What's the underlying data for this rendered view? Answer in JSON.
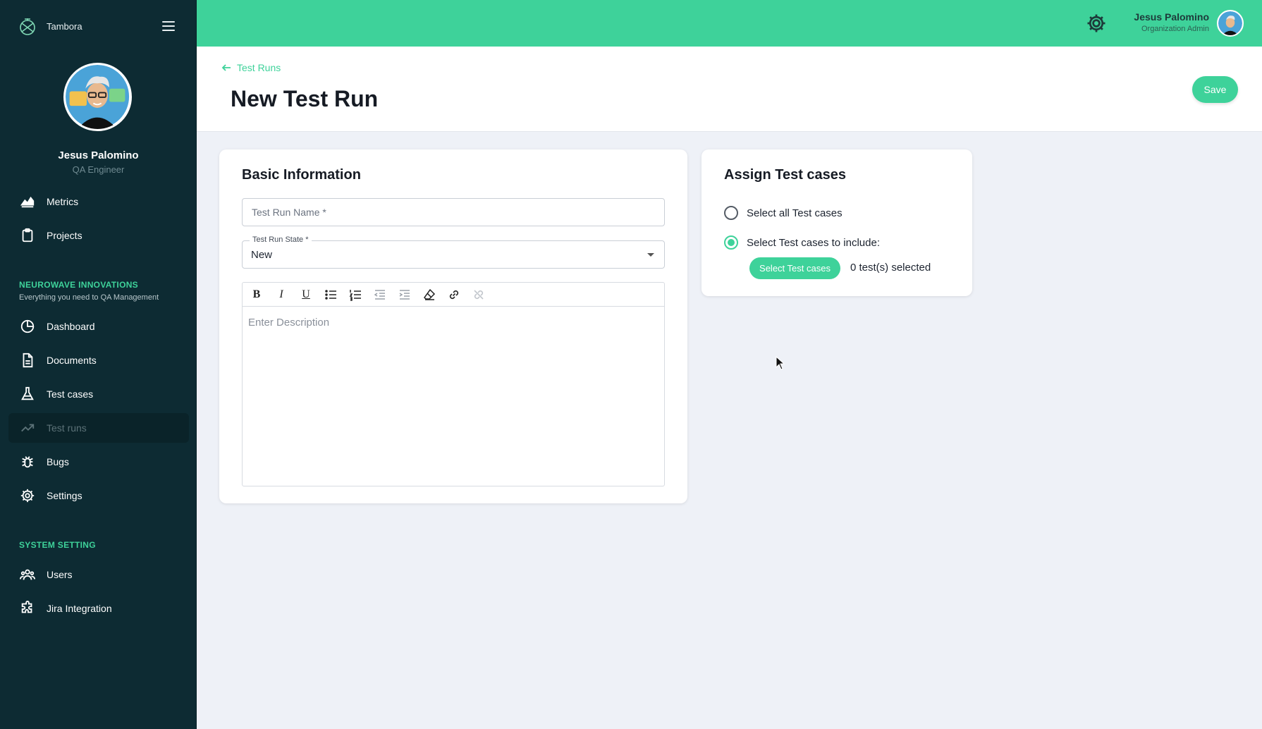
{
  "app": {
    "brand_name": "Tambora"
  },
  "profile": {
    "name": "Jesus Palomino",
    "role": "QA Engineer"
  },
  "sidebar": {
    "top_items": [
      {
        "label": "Metrics",
        "icon": "chart-area-icon"
      },
      {
        "label": "Projects",
        "icon": "clipboard-icon"
      }
    ],
    "org_title": "NEUROWAVE INNOVATIONS",
    "org_subtitle": "Everything you need to QA Management",
    "org_items": [
      {
        "label": "Dashboard",
        "icon": "pie-chart-icon"
      },
      {
        "label": "Documents",
        "icon": "document-icon"
      },
      {
        "label": "Test cases",
        "icon": "flask-icon"
      },
      {
        "label": "Test runs",
        "icon": "trend-up-icon",
        "active": true
      },
      {
        "label": "Bugs",
        "icon": "bug-icon"
      },
      {
        "label": "Settings",
        "icon": "gear-icon"
      }
    ],
    "system_title": "SYSTEM SETTING",
    "system_items": [
      {
        "label": "Users",
        "icon": "users-icon"
      },
      {
        "label": "Jira Integration",
        "icon": "puzzle-icon"
      }
    ]
  },
  "topbar": {
    "user_name": "Jesus Palomino",
    "user_role": "Organization Admin",
    "settings_icon": "gear-icon"
  },
  "header": {
    "back_label": "Test Runs",
    "title": "New Test Run",
    "save_label": "Save"
  },
  "basic_info": {
    "title": "Basic Information",
    "name_placeholder": "Test Run Name *",
    "name_value": "",
    "state_label": "Test Run State *",
    "state_value": "New",
    "description_placeholder": "Enter Description"
  },
  "assign": {
    "title": "Assign Test cases",
    "option_all": "Select all Test cases",
    "option_include": "Select Test cases to include:",
    "selected_option": "include",
    "select_button": "Select Test cases",
    "selected_count": "0 test(s) selected"
  },
  "colors": {
    "accent": "#3ed29a",
    "sidebar_bg": "#0d2b33",
    "page_bg": "#eef1f7"
  }
}
